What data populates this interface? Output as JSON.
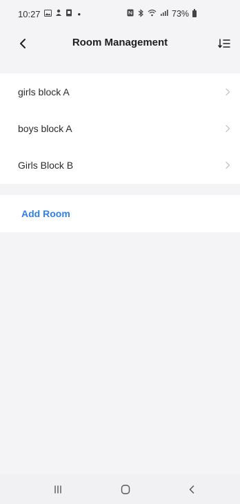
{
  "status_bar": {
    "time": "10:27",
    "left_icons": [
      "gallery-icon",
      "notification-icon",
      "sim-icon"
    ],
    "dot": "•",
    "right_icons": [
      "nfc-icon",
      "bluetooth-icon",
      "wifi-icon",
      "signal-icon"
    ],
    "battery_text": "73%"
  },
  "header": {
    "title": "Room Management",
    "back_icon": "chevron-left-icon",
    "sort_icon": "sort-list-icon"
  },
  "rooms": [
    {
      "label": "girls block A"
    },
    {
      "label": "boys block A"
    },
    {
      "label": "Girls Block B"
    }
  ],
  "add_room_label": "Add Room",
  "colors": {
    "background": "#f4f4f6",
    "card": "#ffffff",
    "accent": "#2f7fe6",
    "chevron": "#c4c4c4"
  },
  "nav": {
    "recent_icon": "recent-apps-icon",
    "home_icon": "home-icon",
    "back_icon": "back-icon"
  }
}
